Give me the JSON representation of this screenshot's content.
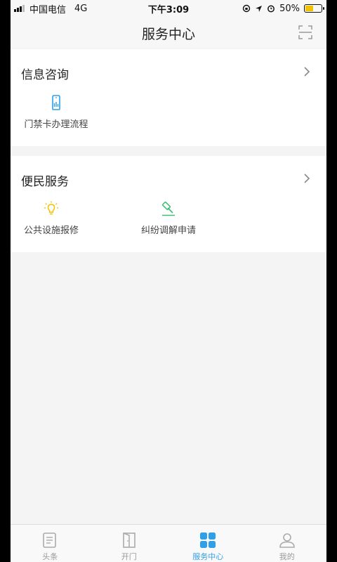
{
  "status_bar": {
    "carrier": "中国电信",
    "network": "4G",
    "time": "下午3:09",
    "battery": "50%",
    "battery_level": 0.5
  },
  "header": {
    "title": "服务中心",
    "scan_icon": "scan-icon"
  },
  "sections": [
    {
      "title": "信息咨询",
      "items": [
        {
          "label": "门禁卡办理流程",
          "icon": "access-card-icon",
          "color": "#2f9fe6"
        }
      ]
    },
    {
      "title": "便民服务",
      "items": [
        {
          "label": "公共设施报修",
          "icon": "lightbulb-icon",
          "color": "#f2c200"
        },
        {
          "label": "纠纷调解申请",
          "icon": "gavel-icon",
          "color": "#3cbf72"
        }
      ]
    }
  ],
  "tabs": [
    {
      "label": "头条",
      "icon": "news-icon",
      "active": false
    },
    {
      "label": "开门",
      "icon": "door-icon",
      "active": false
    },
    {
      "label": "服务中心",
      "icon": "grid-icon",
      "active": true
    },
    {
      "label": "我的",
      "icon": "user-icon",
      "active": false
    }
  ],
  "colors": {
    "accent": "#2f9fe6",
    "background": "#f4f4f4"
  }
}
